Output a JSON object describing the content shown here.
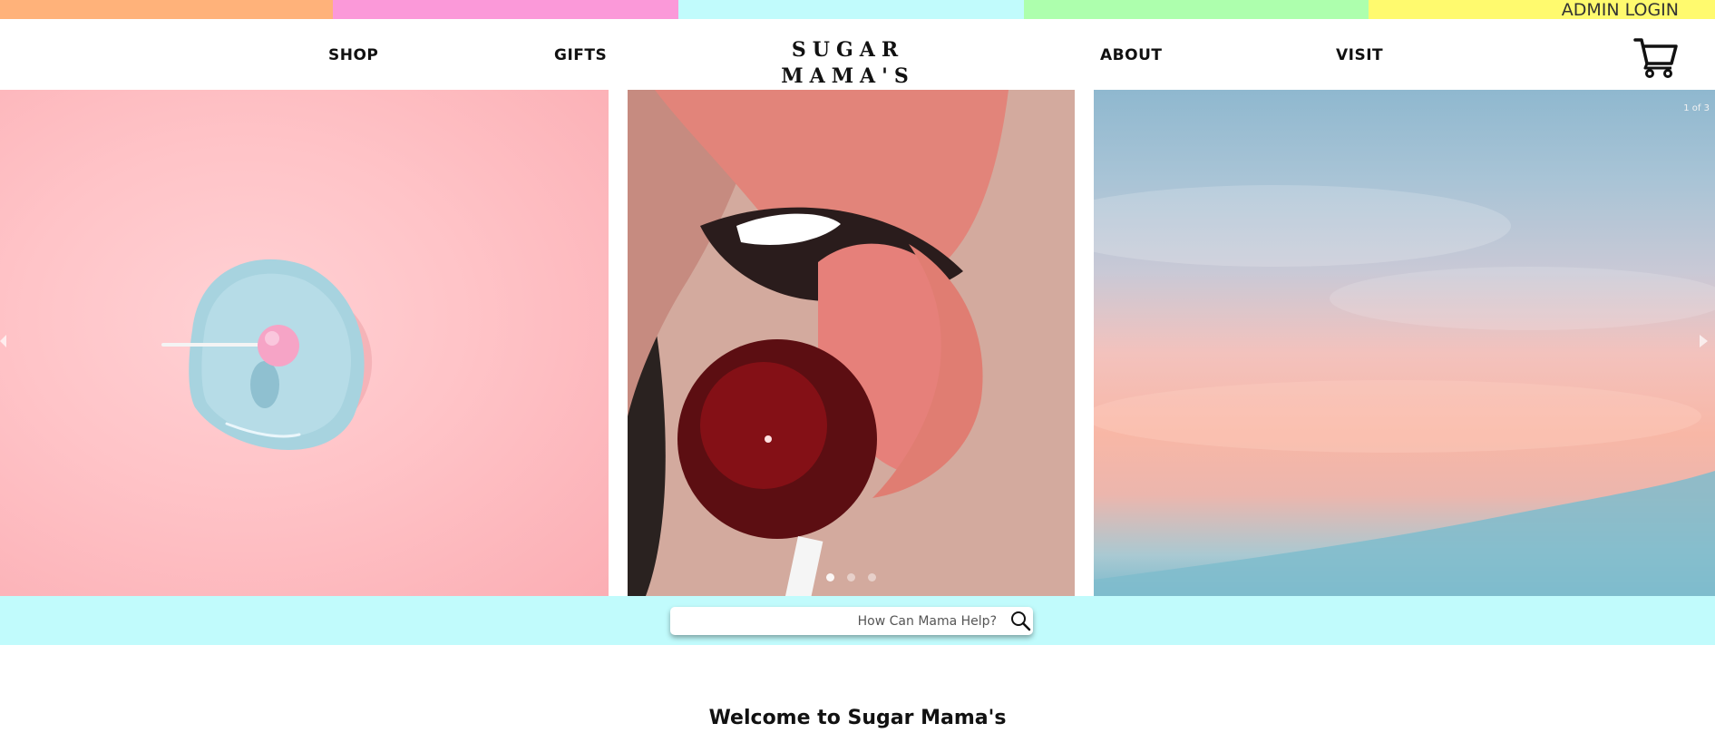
{
  "top_strip": {
    "colors": [
      "#ffb27a",
      "#fb99d9",
      "#c1fbfc",
      "#adffad",
      "#fffa6e"
    ],
    "admin_login": "ADMIN LOGIN"
  },
  "nav": {
    "links": [
      "SHOP",
      "GIFTS",
      "ABOUT",
      "VISIT"
    ],
    "logo_line1": "SUGAR",
    "logo_line2": "MAMA'S",
    "cart_icon": "shopping-cart-icon"
  },
  "carousel": {
    "counter": "1 of 3",
    "slides": [
      "pink background with blue dish and lollipop",
      "lips with red lollipop",
      "pastel sky"
    ],
    "active_dot": 1,
    "dot_count": 3
  },
  "search": {
    "placeholder": "How Can Mama Help?",
    "icon": "search-icon"
  },
  "welcome": {
    "heading": "Welcome to Sugar Mama's"
  }
}
